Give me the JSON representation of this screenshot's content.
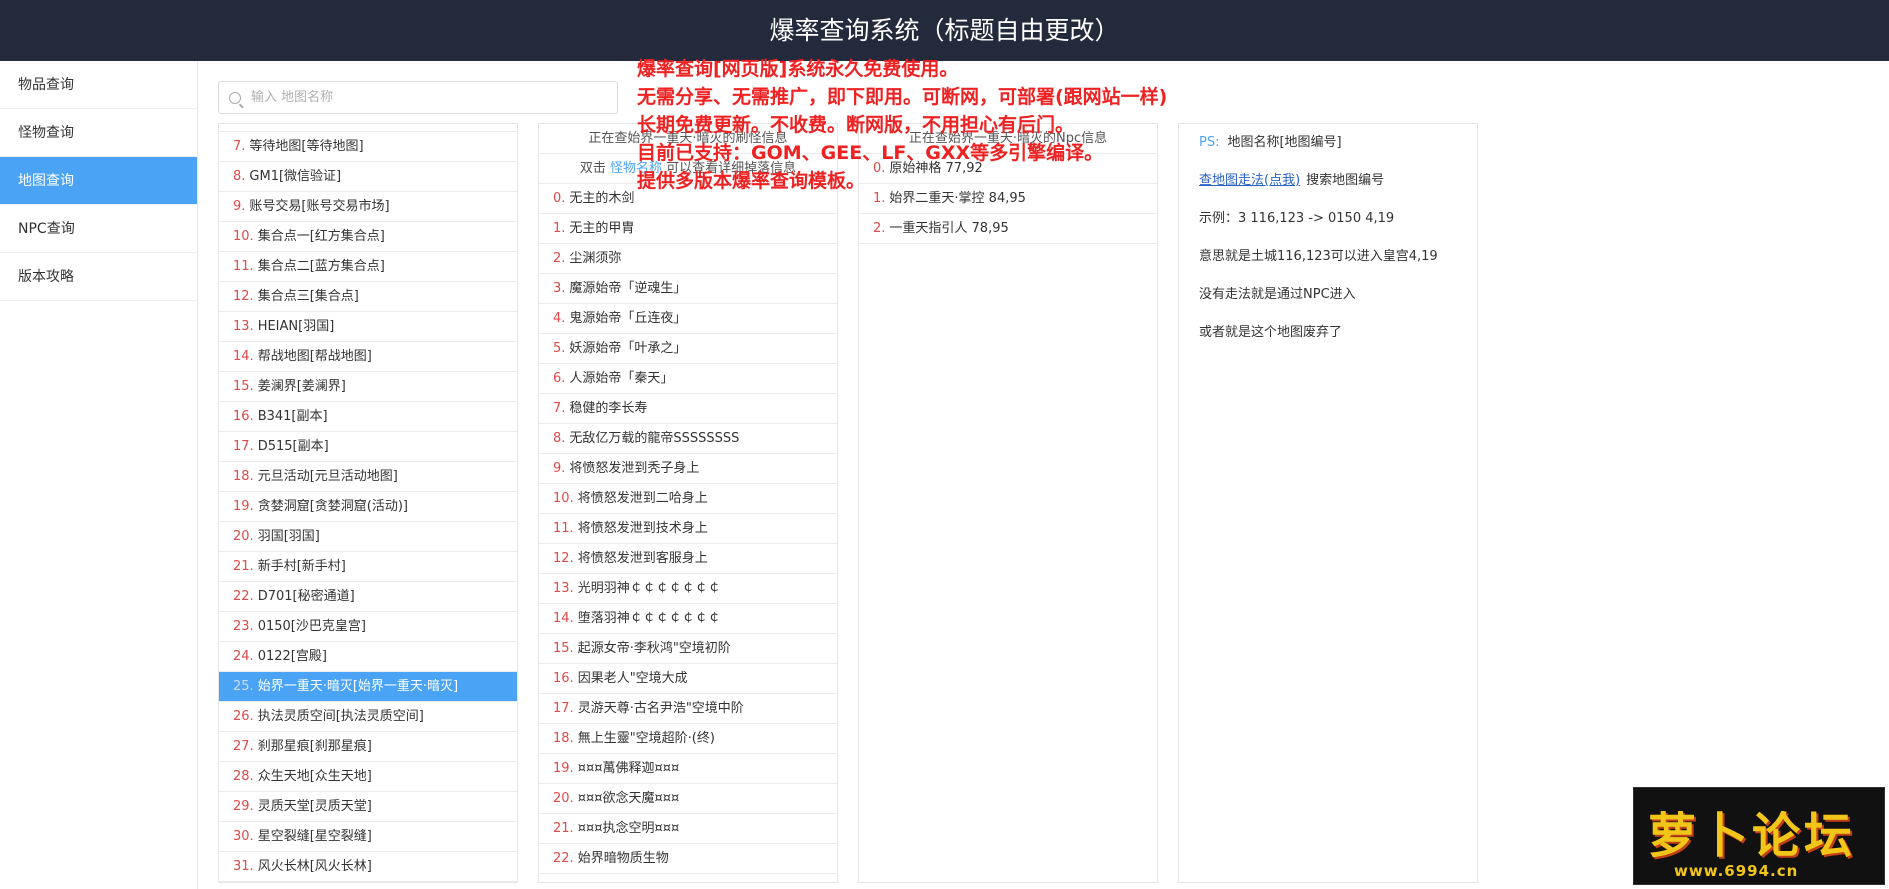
{
  "header": {
    "title": "爆率查询系统（标题自由更改）"
  },
  "sidebar": {
    "items": [
      {
        "label": "物品查询"
      },
      {
        "label": "怪物查询"
      },
      {
        "label": "地图查询"
      },
      {
        "label": "NPC查询"
      },
      {
        "label": "版本攻略"
      }
    ],
    "active_index": 2
  },
  "search": {
    "placeholder": "输入 地图名称"
  },
  "maps": [
    {
      "num": "7.",
      "name": "等待地图[等待地图]"
    },
    {
      "num": "8.",
      "name": "GM1[微信验证]"
    },
    {
      "num": "9.",
      "name": "账号交易[账号交易市场]"
    },
    {
      "num": "10.",
      "name": "集合点一[红方集合点]"
    },
    {
      "num": "11.",
      "name": "集合点二[蓝方集合点]"
    },
    {
      "num": "12.",
      "name": "集合点三[集合点]"
    },
    {
      "num": "13.",
      "name": "HEIAN[羽国]"
    },
    {
      "num": "14.",
      "name": "帮战地图[帮战地图]"
    },
    {
      "num": "15.",
      "name": "姜澜界[姜澜界]"
    },
    {
      "num": "16.",
      "name": "B341[副本]"
    },
    {
      "num": "17.",
      "name": "D515[副本]"
    },
    {
      "num": "18.",
      "name": "元旦活动[元旦活动地图]"
    },
    {
      "num": "19.",
      "name": "贪婪洞窟[贪婪洞窟(活动)]"
    },
    {
      "num": "20.",
      "name": "羽国[羽国]"
    },
    {
      "num": "21.",
      "name": "新手村[新手村]"
    },
    {
      "num": "22.",
      "name": "D701[秘密通道]"
    },
    {
      "num": "23.",
      "name": "0150[沙巴克皇宫]"
    },
    {
      "num": "24.",
      "name": "0122[宫殿]"
    },
    {
      "num": "25.",
      "name": "始界一重天·暗灭[始界一重天·暗灭]"
    },
    {
      "num": "26.",
      "name": "执法灵质空间[执法灵质空间]"
    },
    {
      "num": "27.",
      "name": "刹那星痕[刹那星痕]"
    },
    {
      "num": "28.",
      "name": "众生天地[众生天地]"
    },
    {
      "num": "29.",
      "name": "灵质天堂[灵质天堂]"
    },
    {
      "num": "30.",
      "name": "星空裂缝[星空裂缝]"
    },
    {
      "num": "31.",
      "name": "风火长林[风火长林]"
    }
  ],
  "selected_map_num": "25.",
  "monsters_panel": {
    "head1": "正在查始界一重天·暗灭的刷怪信息",
    "head2_pre": "双击",
    "head2_link": "怪物名称",
    "head2_post": "可以查看详细掉落信息",
    "items": [
      {
        "num": "0.",
        "name": "无主的木剑"
      },
      {
        "num": "1.",
        "name": "无主的甲胄"
      },
      {
        "num": "2.",
        "name": "尘渊须弥"
      },
      {
        "num": "3.",
        "name": "魔源始帝「逆魂生」"
      },
      {
        "num": "4.",
        "name": "鬼源始帝「丘连夜」"
      },
      {
        "num": "5.",
        "name": "妖源始帝「叶承之」"
      },
      {
        "num": "6.",
        "name": "人源始帝「秦天」"
      },
      {
        "num": "7.",
        "name": "稳健的李长寿"
      },
      {
        "num": "8.",
        "name": "无敌亿万载的龍帝SSSSSSSS"
      },
      {
        "num": "9.",
        "name": "将愤怒发泄到秃子身上"
      },
      {
        "num": "10.",
        "name": "将愤怒发泄到二哈身上"
      },
      {
        "num": "11.",
        "name": "将愤怒发泄到技术身上"
      },
      {
        "num": "12.",
        "name": "将愤怒发泄到客服身上"
      },
      {
        "num": "13.",
        "name": "光明羽神￠￠￠￠￠￠￠"
      },
      {
        "num": "14.",
        "name": "堕落羽神￠￠￠￠￠￠￠"
      },
      {
        "num": "15.",
        "name": "起源女帝·李秋鸿\"空境初阶"
      },
      {
        "num": "16.",
        "name": "因果老人\"空境大成"
      },
      {
        "num": "17.",
        "name": "灵游天尊·古名尹浩\"空境中阶"
      },
      {
        "num": "18.",
        "name": "無上生靈\"空境超阶·(终)"
      },
      {
        "num": "19.",
        "name": "¤¤¤萬佛释迦¤¤¤"
      },
      {
        "num": "20.",
        "name": "¤¤¤欲念天魔¤¤¤"
      },
      {
        "num": "21.",
        "name": "¤¤¤执念空明¤¤¤"
      },
      {
        "num": "22.",
        "name": "始界暗物质生物"
      }
    ]
  },
  "npc_panel": {
    "head1": "正在查始界一重天·暗灭的Npc信息",
    "items": [
      {
        "num": "0.",
        "name": "原始神格 77,92"
      },
      {
        "num": "1.",
        "name": "始界二重天·掌控 84,95"
      },
      {
        "num": "2.",
        "name": "一重天指引人 78,95"
      }
    ]
  },
  "info_panel": {
    "ps_label": "PS:",
    "ps_text": "地图名称[地图编号]",
    "link": "查地图走法(点我)",
    "link_suffix": "搜索地图编号",
    "lines": [
      "示例：3 116,123 -> 0150 4,19",
      "意思就是土城116,123可以进入皇宫4,19",
      "没有走法就是通过NPC进入",
      "或者就是这个地图废弃了"
    ]
  },
  "overlay": {
    "lines": [
      "爆率查询[网页版]系统永久免费使用。",
      "无需分享、无需推广，即下即用。可断网，可部署(跟网站一样)",
      "长期免费更新。不收费。断网版，不用担心有后门。",
      "目前已支持：GOM、GEE、LF、GXX等多引擎编译。",
      "提供多版本爆率查询模板。"
    ],
    "color": "#ee2222"
  },
  "watermark": {
    "big": "萝卜论坛",
    "url": "www.6994.cn"
  },
  "colors": {
    "header_bg": "#232a3b",
    "accent": "#4aa3f5",
    "number": "#e04a4a"
  }
}
